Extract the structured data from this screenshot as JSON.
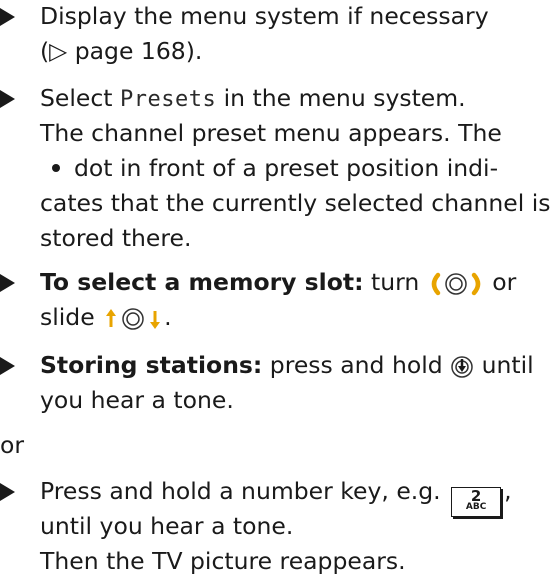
{
  "items": {
    "i1": {
      "l1": "Display the menu system if necessary",
      "l2": "(▷ page 168)."
    },
    "i2": {
      "l1a": "Select ",
      "l1b": "Presets",
      "l1c": " in the menu system.",
      "l2": "The channel preset menu appears. The",
      "l3": "dot in front of a preset position indi-",
      "l4": "cates that the currently selected channel is",
      "l5": "stored there."
    },
    "i3": {
      "bold": "To select a memory slot:",
      "l1a": " turn ",
      "l1b": " or",
      "l2a": "slide ",
      "l2b": "."
    },
    "i4": {
      "bold": "Storing stations:",
      "l1a": " press and hold ",
      "l1b": " until",
      "l2": "you hear a tone."
    },
    "or": "or",
    "i5": {
      "l1a": "Press and hold a number key, e.g. ",
      "l1b": ",",
      "key_num": "2",
      "key_sub": "ABC",
      "l2": "until you hear a tone.",
      "l3": "Then the TV picture reappears."
    }
  },
  "icons": [
    "bullet-triangle-icon",
    "dot-icon",
    "rotate-controller-icon",
    "slide-controller-icon",
    "press-controller-icon"
  ]
}
